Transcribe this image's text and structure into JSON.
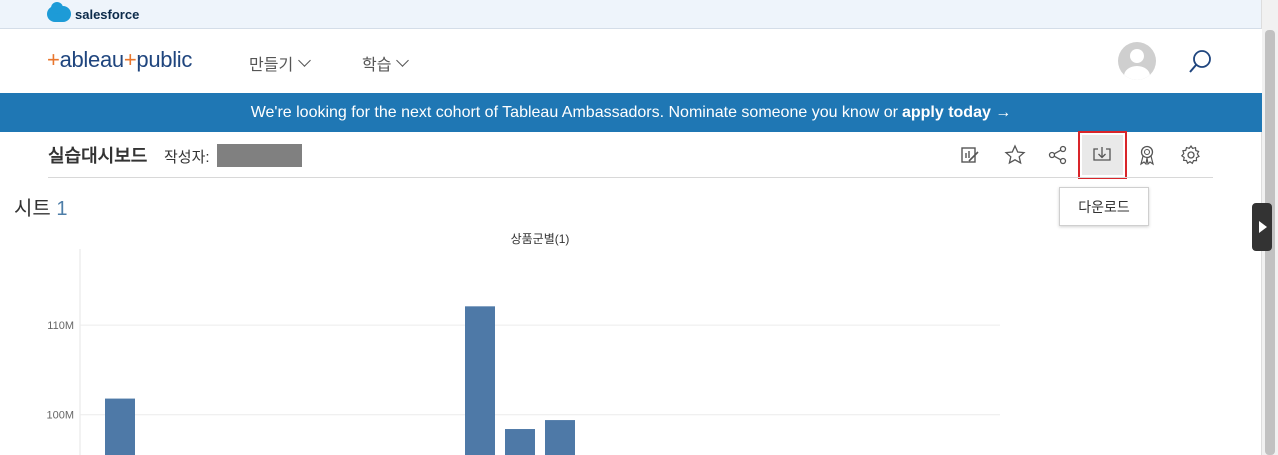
{
  "topbar": {
    "brand": "salesforce"
  },
  "header": {
    "logo": {
      "plus1": "+",
      "part1": "ableau",
      "plus2": "+",
      "part2": "public"
    },
    "nav": [
      {
        "label": "만들기"
      },
      {
        "label": "학습"
      }
    ]
  },
  "banner": {
    "text": "We're looking for the next cohort of Tableau Ambassadors. Nominate someone you know or",
    "link": "apply today →"
  },
  "viz": {
    "title": "실습대시보드",
    "author_label": "작성자:"
  },
  "toolbar": {
    "tooltip": "다운로드",
    "icons": [
      "edit-icon",
      "star-icon",
      "share-icon",
      "download-icon",
      "award-icon",
      "gear-icon"
    ]
  },
  "sheet": {
    "title": "시트",
    "number": "1"
  },
  "colors": {
    "banner": "#1f77b4",
    "bar": "#4e79a7",
    "highlight": "#d9252a"
  },
  "chart_data": {
    "type": "bar",
    "title": "상품군별(1)",
    "xlabel": "",
    "ylabel": "",
    "yticks": [
      {
        "value": 100,
        "label": "100M"
      },
      {
        "value": 110,
        "label": "110M"
      }
    ],
    "ylim": [
      95.5,
      118.5
    ],
    "categories": [
      "",
      "",
      "",
      "",
      "",
      "",
      "",
      "",
      "",
      "",
      "",
      "",
      ""
    ],
    "values": [
      null,
      101.8,
      null,
      null,
      null,
      null,
      null,
      null,
      null,
      null,
      112.1,
      98.4,
      99.4
    ],
    "bar_color": "#4e79a7",
    "grid": true
  }
}
